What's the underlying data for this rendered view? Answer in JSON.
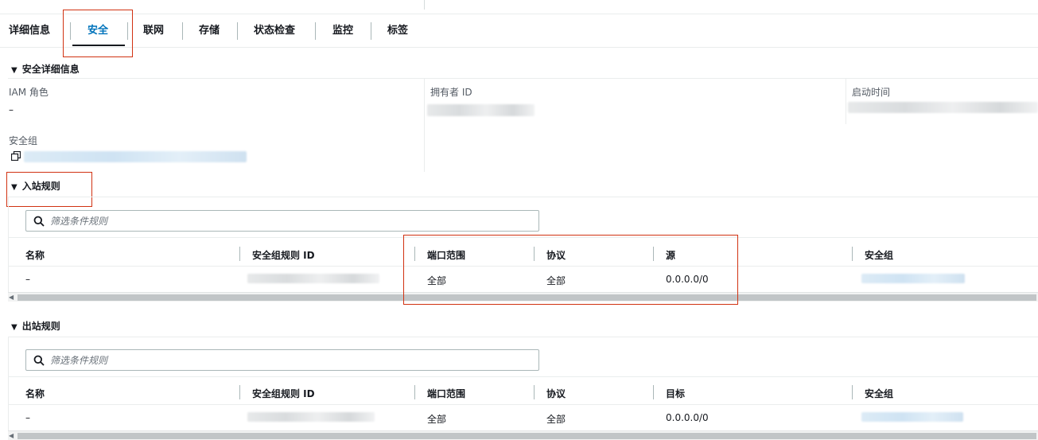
{
  "tabs": [
    {
      "label": "详细信息",
      "active": false
    },
    {
      "label": "安全",
      "active": true
    },
    {
      "label": "联网",
      "active": false
    },
    {
      "label": "存储",
      "active": false
    },
    {
      "label": "状态检查",
      "active": false
    },
    {
      "label": "监控",
      "active": false
    },
    {
      "label": "标签",
      "active": false
    }
  ],
  "security_details": {
    "title": "安全详细信息",
    "iam_role_label": "IAM 角色",
    "iam_role_value": "–",
    "owner_id_label": "拥有者 ID",
    "launch_time_label": "启动时间",
    "security_group_label": "安全组"
  },
  "inbound": {
    "title": "入站规则",
    "filter_placeholder": "筛选条件规则",
    "columns": [
      "名称",
      "安全组规则 ID",
      "端口范围",
      "协议",
      "源",
      "安全组"
    ],
    "rows": [
      {
        "name": "–",
        "port_range": "全部",
        "protocol": "全部",
        "source": "0.0.0.0/0"
      }
    ]
  },
  "outbound": {
    "title": "出站规则",
    "filter_placeholder": "筛选条件规则",
    "columns": [
      "名称",
      "安全组规则 ID",
      "端口范围",
      "协议",
      "目标",
      "安全组"
    ],
    "rows": [
      {
        "name": "–",
        "port_range": "全部",
        "protocol": "全部",
        "destination": "0.0.0.0/0"
      }
    ]
  },
  "colors": {
    "active_tab": "#0073bb",
    "highlight_box": "#d13212",
    "text": "#16191f",
    "muted": "#545b64"
  },
  "icons": [
    "copy-icon",
    "search-icon",
    "caret-down-icon"
  ]
}
